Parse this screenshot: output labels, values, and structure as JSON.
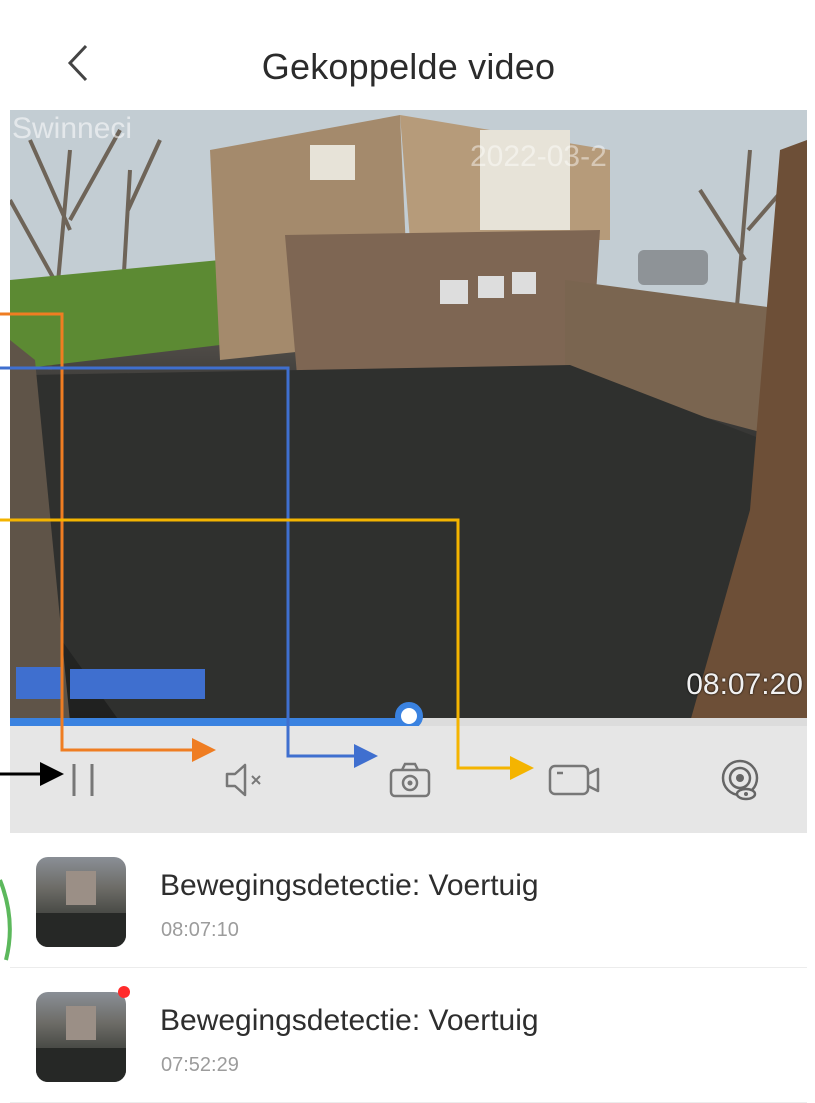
{
  "header": {
    "title": "Gekoppelde video"
  },
  "video": {
    "camera_label": "Swinneci",
    "date_overlay": "2022-03-2",
    "timecode": "08:07:20",
    "progress": 0.5
  },
  "controls": {
    "buttons": [
      {
        "name": "pause-button",
        "icon": "pause-icon"
      },
      {
        "name": "mute-button",
        "icon": "speaker-muted-icon"
      },
      {
        "name": "snapshot-button",
        "icon": "camera-icon"
      },
      {
        "name": "record-button",
        "icon": "video-camera-icon"
      },
      {
        "name": "watch-button",
        "icon": "eye-target-icon"
      }
    ]
  },
  "events": [
    {
      "title": "Bewegingsdetectie: Voertuig",
      "time": "08:07:10",
      "unread": false
    },
    {
      "title": "Bewegingsdetectie: Voertuig",
      "time": "07:52:29",
      "unread": true
    }
  ],
  "annotation_colors": {
    "orange": "#ef7d22",
    "blue": "#3f6fcf",
    "yellow": "#f4b400",
    "black": "#000000",
    "green": "#5cb85c"
  }
}
